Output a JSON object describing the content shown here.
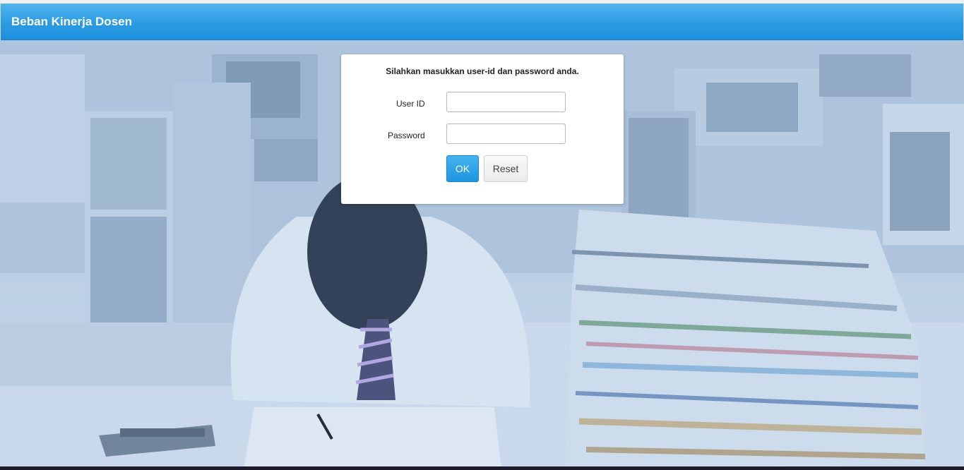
{
  "header": {
    "title": "Beban Kinerja Dosen"
  },
  "login": {
    "instruction": "Silahkan masukkan user-id dan password anda.",
    "user_label": "User ID",
    "password_label": "Password",
    "user_value": "",
    "password_value": "",
    "ok_label": "OK",
    "reset_label": "Reset"
  },
  "colors": {
    "header": "#2a9be3",
    "ok_button": "#1f95e0",
    "background_tint": "#c3d5e8"
  }
}
